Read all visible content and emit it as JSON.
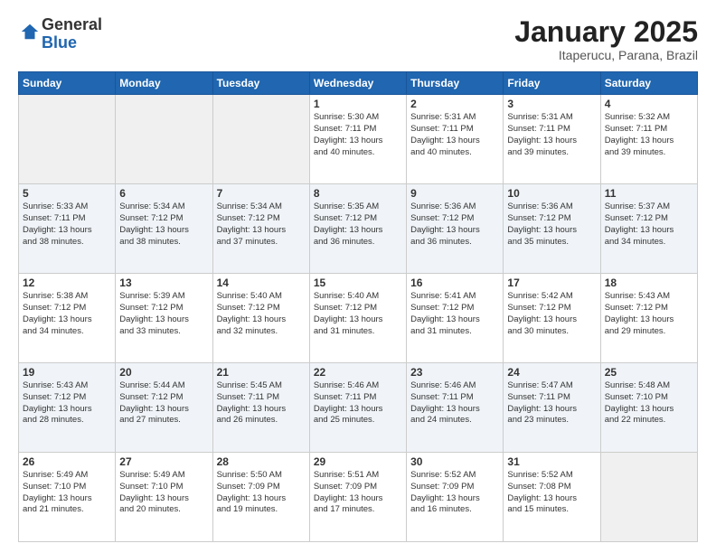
{
  "header": {
    "logo_general": "General",
    "logo_blue": "Blue",
    "month_title": "January 2025",
    "location": "Itaperucu, Parana, Brazil"
  },
  "days_of_week": [
    "Sunday",
    "Monday",
    "Tuesday",
    "Wednesday",
    "Thursday",
    "Friday",
    "Saturday"
  ],
  "weeks": [
    [
      {
        "num": "",
        "info": ""
      },
      {
        "num": "",
        "info": ""
      },
      {
        "num": "",
        "info": ""
      },
      {
        "num": "1",
        "info": "Sunrise: 5:30 AM\nSunset: 7:11 PM\nDaylight: 13 hours\nand 40 minutes."
      },
      {
        "num": "2",
        "info": "Sunrise: 5:31 AM\nSunset: 7:11 PM\nDaylight: 13 hours\nand 40 minutes."
      },
      {
        "num": "3",
        "info": "Sunrise: 5:31 AM\nSunset: 7:11 PM\nDaylight: 13 hours\nand 39 minutes."
      },
      {
        "num": "4",
        "info": "Sunrise: 5:32 AM\nSunset: 7:11 PM\nDaylight: 13 hours\nand 39 minutes."
      }
    ],
    [
      {
        "num": "5",
        "info": "Sunrise: 5:33 AM\nSunset: 7:11 PM\nDaylight: 13 hours\nand 38 minutes."
      },
      {
        "num": "6",
        "info": "Sunrise: 5:34 AM\nSunset: 7:12 PM\nDaylight: 13 hours\nand 38 minutes."
      },
      {
        "num": "7",
        "info": "Sunrise: 5:34 AM\nSunset: 7:12 PM\nDaylight: 13 hours\nand 37 minutes."
      },
      {
        "num": "8",
        "info": "Sunrise: 5:35 AM\nSunset: 7:12 PM\nDaylight: 13 hours\nand 36 minutes."
      },
      {
        "num": "9",
        "info": "Sunrise: 5:36 AM\nSunset: 7:12 PM\nDaylight: 13 hours\nand 36 minutes."
      },
      {
        "num": "10",
        "info": "Sunrise: 5:36 AM\nSunset: 7:12 PM\nDaylight: 13 hours\nand 35 minutes."
      },
      {
        "num": "11",
        "info": "Sunrise: 5:37 AM\nSunset: 7:12 PM\nDaylight: 13 hours\nand 34 minutes."
      }
    ],
    [
      {
        "num": "12",
        "info": "Sunrise: 5:38 AM\nSunset: 7:12 PM\nDaylight: 13 hours\nand 34 minutes."
      },
      {
        "num": "13",
        "info": "Sunrise: 5:39 AM\nSunset: 7:12 PM\nDaylight: 13 hours\nand 33 minutes."
      },
      {
        "num": "14",
        "info": "Sunrise: 5:40 AM\nSunset: 7:12 PM\nDaylight: 13 hours\nand 32 minutes."
      },
      {
        "num": "15",
        "info": "Sunrise: 5:40 AM\nSunset: 7:12 PM\nDaylight: 13 hours\nand 31 minutes."
      },
      {
        "num": "16",
        "info": "Sunrise: 5:41 AM\nSunset: 7:12 PM\nDaylight: 13 hours\nand 31 minutes."
      },
      {
        "num": "17",
        "info": "Sunrise: 5:42 AM\nSunset: 7:12 PM\nDaylight: 13 hours\nand 30 minutes."
      },
      {
        "num": "18",
        "info": "Sunrise: 5:43 AM\nSunset: 7:12 PM\nDaylight: 13 hours\nand 29 minutes."
      }
    ],
    [
      {
        "num": "19",
        "info": "Sunrise: 5:43 AM\nSunset: 7:12 PM\nDaylight: 13 hours\nand 28 minutes."
      },
      {
        "num": "20",
        "info": "Sunrise: 5:44 AM\nSunset: 7:12 PM\nDaylight: 13 hours\nand 27 minutes."
      },
      {
        "num": "21",
        "info": "Sunrise: 5:45 AM\nSunset: 7:11 PM\nDaylight: 13 hours\nand 26 minutes."
      },
      {
        "num": "22",
        "info": "Sunrise: 5:46 AM\nSunset: 7:11 PM\nDaylight: 13 hours\nand 25 minutes."
      },
      {
        "num": "23",
        "info": "Sunrise: 5:46 AM\nSunset: 7:11 PM\nDaylight: 13 hours\nand 24 minutes."
      },
      {
        "num": "24",
        "info": "Sunrise: 5:47 AM\nSunset: 7:11 PM\nDaylight: 13 hours\nand 23 minutes."
      },
      {
        "num": "25",
        "info": "Sunrise: 5:48 AM\nSunset: 7:10 PM\nDaylight: 13 hours\nand 22 minutes."
      }
    ],
    [
      {
        "num": "26",
        "info": "Sunrise: 5:49 AM\nSunset: 7:10 PM\nDaylight: 13 hours\nand 21 minutes."
      },
      {
        "num": "27",
        "info": "Sunrise: 5:49 AM\nSunset: 7:10 PM\nDaylight: 13 hours\nand 20 minutes."
      },
      {
        "num": "28",
        "info": "Sunrise: 5:50 AM\nSunset: 7:09 PM\nDaylight: 13 hours\nand 19 minutes."
      },
      {
        "num": "29",
        "info": "Sunrise: 5:51 AM\nSunset: 7:09 PM\nDaylight: 13 hours\nand 17 minutes."
      },
      {
        "num": "30",
        "info": "Sunrise: 5:52 AM\nSunset: 7:09 PM\nDaylight: 13 hours\nand 16 minutes."
      },
      {
        "num": "31",
        "info": "Sunrise: 5:52 AM\nSunset: 7:08 PM\nDaylight: 13 hours\nand 15 minutes."
      },
      {
        "num": "",
        "info": ""
      }
    ]
  ]
}
